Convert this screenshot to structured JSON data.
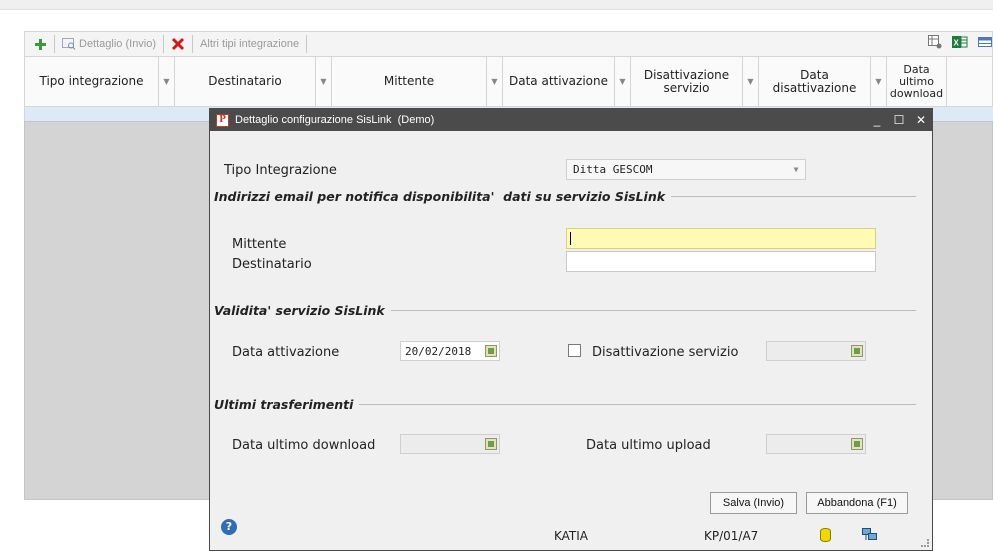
{
  "toolbar": {
    "add_icon": "plus-icon",
    "detail_label": "Dettaglio (Invio)",
    "delete_icon": "delete-x-icon",
    "other_label": "Altri tipi integrazione",
    "right_icons": [
      "grid-settings-icon",
      "excel-icon",
      "table-icon"
    ]
  },
  "grid": {
    "columns": [
      "Tipo integrazione",
      "Destinatario",
      "Mittente",
      "Data attivazione",
      "Disattivazione servizio",
      "Data disattivazione",
      "Data ultimo download"
    ]
  },
  "dialog": {
    "title": "Dettaglio configurazione SisLink  (Demo)",
    "tipo_integrazione_label": "Tipo Integrazione",
    "tipo_integrazione_value": "Ditta GESCOM",
    "section_email": "Indirizzi email per notifica disponibilita'  dati su servizio SisLink",
    "mittente_label": "Mittente",
    "mittente_value": "",
    "destinatario_label": "Destinatario",
    "destinatario_value": "",
    "section_validita": "Validita' servizio SisLink",
    "data_attivazione_label": "Data attivazione",
    "data_attivazione_value": "20/02/2018",
    "disattivazione_label": "Disattivazione servizio",
    "disattivazione_checked": false,
    "section_trasferimenti": "Ultimi trasferimenti",
    "data_download_label": "Data ultimo download",
    "data_upload_label": "Data ultimo upload",
    "save_label": "Salva (Invio)",
    "cancel_label": "Abbandona (F1)",
    "status_user": "KATIA",
    "status_code": "KP/01/A7"
  }
}
